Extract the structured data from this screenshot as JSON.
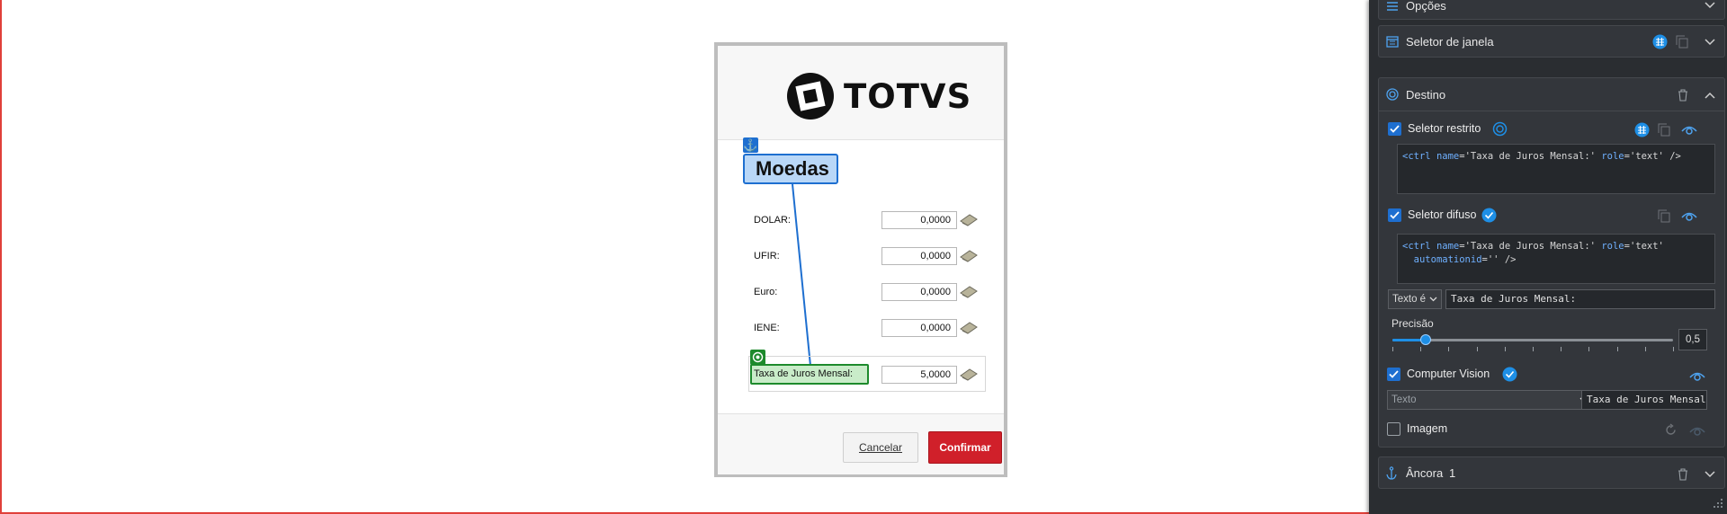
{
  "dialog": {
    "brand": "TOTVS",
    "group_title": "Moedas",
    "rows": [
      {
        "label": "DOLAR:",
        "value": "0,0000"
      },
      {
        "label": "UFIR:",
        "value": "0,0000"
      },
      {
        "label": "Euro:",
        "value": "0,0000"
      },
      {
        "label": "IENE:",
        "value": "0,0000"
      }
    ],
    "target_label": "Taxa de Juros Mensal:",
    "target_value": "5,0000",
    "cancel_label": "Cancelar",
    "confirm_label": "Confirmar",
    "colors": {
      "anchor": "#1e6fd0",
      "target": "#1d8a2c",
      "confirm": "#d0202a"
    }
  },
  "panel": {
    "options_title": "Opções",
    "window_selector_title": "Seletor de janela",
    "target_section_title": "Destino",
    "strict_selector": {
      "label": "Seletor restrito",
      "checked": true,
      "code": {
        "tag": "ctrl",
        "attr1": "name",
        "val1": "'Taxa de Juros Mensal:'",
        "attr2": "role",
        "val2": "'text'"
      }
    },
    "fuzzy_selector": {
      "label": "Seletor difuso",
      "checked": true,
      "code": {
        "tag": "ctrl",
        "attr1": "name",
        "val1": "'Taxa de Juros Mensal:'",
        "attr2": "role",
        "val2": "'text'",
        "attr3": "automationid",
        "val3": "''"
      }
    },
    "text_match": {
      "select": "Texto é",
      "value": "Taxa de Juros Mensal:"
    },
    "precision": {
      "label": "Precisão",
      "value": "0,5",
      "fraction": 0.12
    },
    "computer_vision": {
      "label": "Computer Vision",
      "checked": true,
      "select": "Texto",
      "value": "Taxa de Juros Mensal:"
    },
    "image": {
      "label": "Imagem",
      "checked": false
    },
    "anchor_section": {
      "title": "Âncora",
      "count": "1"
    },
    "colors": {
      "background": "#2a2d31",
      "accent": "#1e8fe6"
    }
  }
}
